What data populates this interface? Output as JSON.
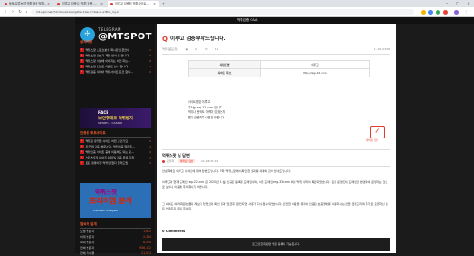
{
  "browser": {
    "tabs": [
      {
        "label": "토토 유튜브가 먹튀검증 먹튀…"
      },
      {
        "label": "이루고 검증 ㅁ 먹튀 검증 …"
      },
      {
        "label": "이루고 검증된 먹튀사이트 …"
      }
    ],
    "close_glyph": "×",
    "new_tab_glyph": "+",
    "url": "mt-spot.net/?do=board-bang-the-t-tah-r=taki-o-e?Bbc_1q-C",
    "icons": [
      "back-icon",
      "forward-icon",
      "reload-icon",
      "home-icon",
      "star-icon",
      "extension-icon",
      "profile-icon",
      "menu-icon"
    ]
  },
  "topnav": {
    "menu": "먹튀검증 Q&A"
  },
  "sidebar": {
    "logo": {
      "top": "TELEGRAM",
      "main": "@MTSPOT",
      "glyph": "✈"
    },
    "section1_title": "공지사항",
    "notices": [
      {
        "label": "먹튀스팟 스포츠분석 제시판 오픈안내",
        "count": "11"
      },
      {
        "label": "먹튀스팟 글쓰기 제한 안내 문 입니다.",
        "count": "10"
      },
      {
        "label": "먹튀스팟 사설에 이어지는 이건 하는…",
        "count": "8"
      },
      {
        "label": "먹튀스팟 포인트 이벤트 실시 합니다.",
        "count": "7"
      },
      {
        "label": "먹튀검증 이이어 먹튀사이트 요건 합니…",
        "count": "9"
      }
    ],
    "banner1": {
      "title": "FACE",
      "headline": "보안형태로 먹튀방지",
      "sub": "SPORTS · CASINO"
    },
    "section2_title": "인증된 토토사이트",
    "verified": [
      {
        "label": "먹튀로 유명한 사이트 어떤 곳인가요",
        "count": "5"
      },
      {
        "label": "두 군데 검증 해주세요. 먹튀검증 알려주…",
        "count": "4"
      },
      {
        "label": "먹튀인증 사이트 중에 이용해도 되는 곳…",
        "count": "6"
      },
      {
        "label": "스포츠토토 사이트 100% 검증 완료 요청",
        "count": "3"
      },
      {
        "label": "토토 유튜버가 먹튀 당했다 알려드립",
        "count": "2"
      }
    ],
    "banner2": {
      "line1": "먹튀스팟",
      "line2": "프리미엄 분석",
      "line3": "Premium Analysis"
    },
    "section3_title": "접속자 집계",
    "stats": [
      {
        "label": "오늘 방문자",
        "value": "1,612"
      },
      {
        "label": "어제 방문자",
        "value": "2,384"
      },
      {
        "label": "최대 방문자",
        "value": "8,540"
      },
      {
        "label": "전체 방문자",
        "value": "936,112"
      },
      {
        "label": "전체 게시물",
        "value": "21,073"
      }
    ]
  },
  "post": {
    "q_glyph": "Q",
    "title": "이루고 검증부탁드립니다.",
    "author": "먹튀검증요청",
    "views": "0",
    "comments": "11",
    "date": "11.26 03:38",
    "info": [
      {
        "key": "사이트명",
        "value": "이루고"
      },
      {
        "key": "사이트 주소",
        "value": "http://erg-22.com"
      }
    ],
    "body": [
      "사이트명은 이루고",
      "주소는 erg-22.com 입니다",
      "먹튀나 문제도 이력이 있었는지",
      "빨리 검증해주시면 감사합니다"
    ]
  },
  "answer": {
    "title": "먹튀스팟 님 답변",
    "author": "관리자",
    "tag": "채택된 답변",
    "date": "11.26 05:12",
    "check_glyph": "✓",
    "check_label": "채택된 답변",
    "paragraphs": [
      "안녕하세요 이루고 사이트에 대해 답변드립니다. 저희 먹튀스팟에서 확인한 결과를 아래와 같이 안내드립니다.",
      "이루고의 현재 도메인 erg-22.com 은 2020년 11월 신규로 등록된 도메인이며, 이전 도메인 erg-33.com 에서 먹튀 이력이 확인되었습니다. 같은 운영진이 도메인만 변경하여 운영하는 것으로 보이니 이용에 주의하시기 바랍니다.",
      "그 외에도 여러 회원님들의 제보가 있었으며 확인 결과 입금 후 환전 지연 사례가 다수 접수되었습니다. 안전한 이용을 위하여 인증된 보증업체를 이용하시는 것을 권장드리며 추가로 궁금하신 점은 언제든지 문의 주세요."
    ]
  },
  "comments": {
    "title": "0 Comments",
    "notice": "로그인한 회원만 댓글 등록이 가능합니다."
  }
}
